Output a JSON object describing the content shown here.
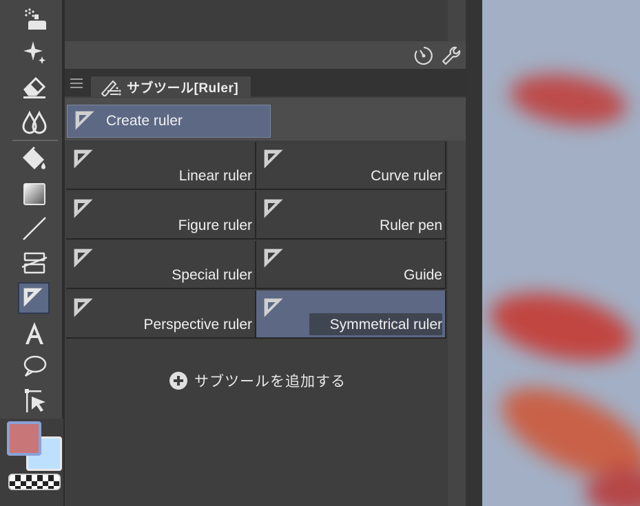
{
  "panel": {
    "tab_title": "サブツール[Ruler]",
    "group_button": "Create ruler",
    "subtools": [
      {
        "label": "Linear ruler",
        "selected": false
      },
      {
        "label": "Curve ruler",
        "selected": false
      },
      {
        "label": "Figure ruler",
        "selected": false
      },
      {
        "label": "Ruler pen",
        "selected": false
      },
      {
        "label": "Special ruler",
        "selected": false
      },
      {
        "label": "Guide",
        "selected": false
      },
      {
        "label": "Perspective ruler",
        "selected": false
      },
      {
        "label": "Symmetrical ruler",
        "selected": true
      }
    ],
    "add_subtool_label": "サブツールを追加する"
  },
  "toolbar_icons": [
    "timer-icon",
    "wrench-icon"
  ],
  "tools": [
    "airbrush-icon",
    "sparkle-icon",
    "eraser-icon",
    "blend-icon",
    "fill-icon",
    "gradient-icon",
    "line-icon",
    "frame-icon",
    "ruler-icon",
    "text-icon",
    "balloon-icon",
    "operation-icon"
  ],
  "active_tool": "ruler-icon",
  "colors": {
    "main": "#c87678",
    "sub": "#bde0ff",
    "accent": "#5c6884"
  }
}
